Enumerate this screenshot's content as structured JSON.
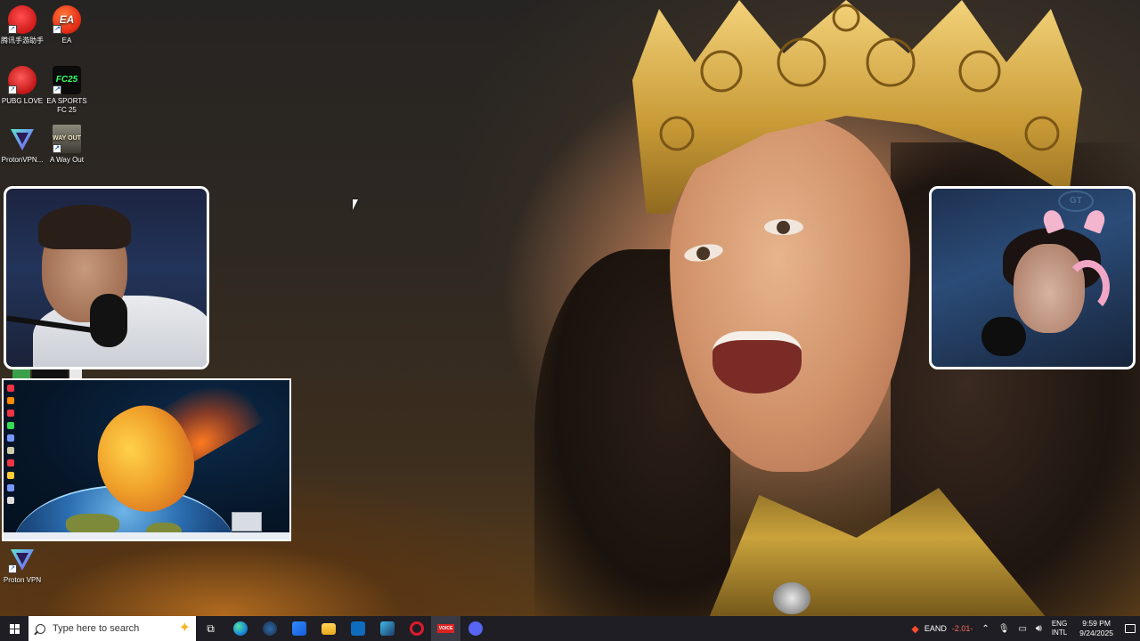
{
  "desktop": {
    "icons": [
      {
        "label": "腾讯手游助手",
        "glyph": "",
        "kind": "tencent"
      },
      {
        "label": "EA",
        "glyph": "EA",
        "kind": "ea"
      },
      {
        "label": "PUBG LOVE",
        "glyph": "",
        "kind": "pubg"
      },
      {
        "label": "EA SPORTS FC 25",
        "glyph": "FC25",
        "kind": "fc"
      },
      {
        "label": "ProtonVPN...",
        "glyph": "",
        "kind": "proton"
      },
      {
        "label": "A Way Out",
        "glyph": "WAY OUT",
        "kind": "way"
      },
      {
        "label": "Proton VPN",
        "glyph": "",
        "kind": "proton"
      }
    ]
  },
  "webcams": {
    "right_logo": "GT"
  },
  "taskbar": {
    "search_placeholder": "Type here to search",
    "pinned": [
      {
        "name": "task-view-icon",
        "glyph": "⧉"
      },
      {
        "name": "edge-icon",
        "glyph": ""
      },
      {
        "name": "steam-icon",
        "glyph": ""
      },
      {
        "name": "store-icon",
        "glyph": ""
      },
      {
        "name": "file-explorer-icon",
        "glyph": ""
      },
      {
        "name": "outlook-icon",
        "glyph": ""
      },
      {
        "name": "app-icon",
        "glyph": ""
      },
      {
        "name": "opera-icon",
        "glyph": ""
      },
      {
        "name": "voicemeeter-icon",
        "glyph": "VOICE"
      },
      {
        "name": "discord-icon",
        "glyph": ""
      }
    ],
    "tray": {
      "stock_label": "EAND",
      "stock_change": "-2.01-",
      "language_top": "ENG",
      "language_bottom": "INTL",
      "time": "9:59 PM",
      "date": "9/24/2025"
    }
  },
  "colors": {
    "taskbar_bg": "#1e1e24",
    "stock_negative": "#ff6b5a",
    "frame_border": "#ffffff"
  }
}
